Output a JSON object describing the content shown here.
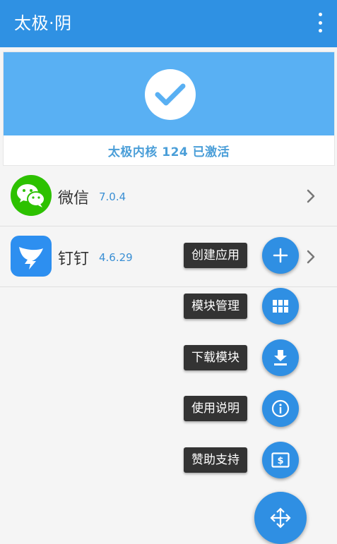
{
  "appbar": {
    "title": "太极·阴",
    "menu_icon": "more-vert-icon"
  },
  "status": {
    "text": "太极内核 124 已激活",
    "icon": "check-icon",
    "banner_color": "#59b0f3"
  },
  "apps": [
    {
      "name": "微信",
      "version": "7.0.4",
      "icon": "wechat-icon"
    },
    {
      "name": "钉钉",
      "version": "4.6.29",
      "icon": "dingtalk-icon"
    }
  ],
  "fab_menu": [
    {
      "label": "创建应用",
      "icon": "plus-icon"
    },
    {
      "label": "模块管理",
      "icon": "grid-icon"
    },
    {
      "label": "下载模块",
      "icon": "download-icon"
    },
    {
      "label": "使用说明",
      "icon": "info-icon"
    },
    {
      "label": "赞助支持",
      "icon": "dollar-icon"
    }
  ],
  "fab_main_icon": "move-arrows-icon",
  "colors": {
    "primary": "#2f91e3",
    "accent_text": "#3a8fd4"
  }
}
